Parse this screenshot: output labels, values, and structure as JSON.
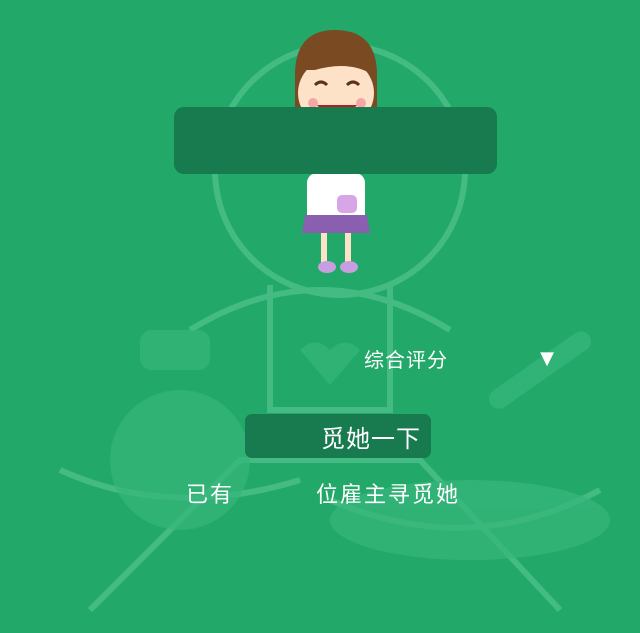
{
  "sort": {
    "label": "综合评分",
    "arrow_icon": "triangle-down-icon"
  },
  "find_button": {
    "label": "觅她一下"
  },
  "stats": {
    "prefix": "已有",
    "suffix": "位雇主寻觅她"
  },
  "colors": {
    "background": "#22a96a",
    "panel": "#187a4f"
  }
}
